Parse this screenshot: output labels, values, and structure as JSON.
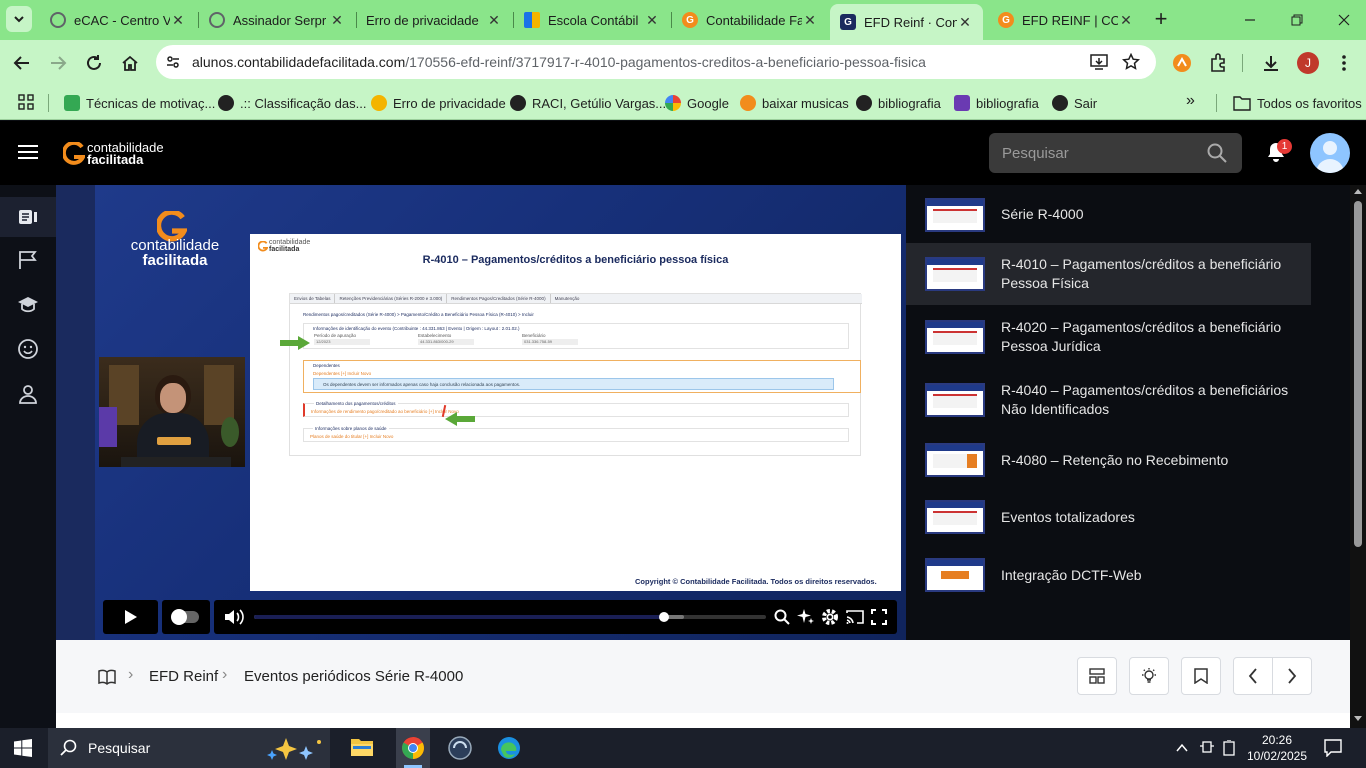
{
  "browser": {
    "tabs": [
      {
        "title": "eCAC - Centro V",
        "favicon": "globe-icon",
        "color": "#5f6368"
      },
      {
        "title": "Assinador Serpr",
        "favicon": "globe-icon",
        "color": "#5f6368"
      },
      {
        "title": "Erro de privacidade",
        "favicon": "none",
        "color": "#5f6368"
      },
      {
        "title": "Escola Contábil",
        "favicon": "windows-grid-icon",
        "color": "#1a73e8"
      },
      {
        "title": "Contabilidade Fa",
        "favicon": "cf-logo-icon",
        "color": "#f28c1c"
      },
      {
        "title": "EFD Reinf · Cont",
        "favicon": "cf-logo-dark-icon",
        "color": "#1a2a5e"
      },
      {
        "title": "EFD REINF | CON",
        "favicon": "cf-logo-icon",
        "color": "#f28c1c"
      }
    ],
    "url_host": "alunos.contabilidadefacilitada.com",
    "url_path": "/170556-efd-reinf/3717917-r-4010-pagamentos-creditos-a-beneficiario-pessoa-fisica",
    "profile_initial": "J",
    "bookmarks": [
      {
        "label": "Técnicas de motivaç...",
        "color": "#34a853"
      },
      {
        "label": ".:: Classificação das...",
        "color": "#222222"
      },
      {
        "label": "Erro de privacidade",
        "color": "#f4b400"
      },
      {
        "label": "RACI, Getúlio Vargas...",
        "color": "#222222"
      },
      {
        "label": "Google",
        "color": "#4285f4"
      },
      {
        "label": "baixar musicas",
        "color": "#f28c1c"
      },
      {
        "label": "bibliografia",
        "color": "#222222"
      },
      {
        "label": "bibliografia",
        "color": "#6a3ab2"
      },
      {
        "label": "Sair",
        "color": "#222222"
      }
    ],
    "all_bookmarks": "Todos os favoritos"
  },
  "site": {
    "logo_line1": "contabilidade",
    "logo_line2": "facilitada",
    "search_placeholder": "Pesquisar",
    "notification_count": "1"
  },
  "slide": {
    "brand_line1": "contabilidade",
    "brand_line2": "facilitada",
    "small_logo_line1": "contabilidade",
    "small_logo_line2": "facilitada",
    "title": "R-4010 – Pagamentos/créditos a beneficiário pessoa física",
    "tabs": [
      "Envios de Tabelas",
      "Retenções Previdenciárias (Séries R-2000 e 3.000)",
      "Rendimentos Pagos/Creditados (Série R-4000)",
      "Manutenção"
    ],
    "breadcrumb": "Rendimentos pagos/creditados (Série R-4000) > Pagamento/Crédito a Beneficiário Pessoa Física (R-4010) > Incluir",
    "section1": "Informações de identificação do evento (Contribuinte : 44.331.863 | Evento | Origem : Layout : 2.01.02.)",
    "field1_label": "Período de apuração",
    "field1_value": "12/2023",
    "field2_label": "Estabelecimento",
    "field2_value": "44.331.863/000-29",
    "field3_label": "Beneficiário",
    "field3_value": "031.336.758-59",
    "section2": "Dependentes",
    "section2_link": "Dependentes  [+] Incluir Novo",
    "section2_info": "Os dependentes devem ser informados apenas caso haja conclusão relacionada aos pagamentos.",
    "section3": "Detalhamento dos pagamentos/créditos",
    "section3_link": "Informações de rendimento pago/creditado ao beneficiário  [+] Incluir Novo",
    "section4": "Informações sobre planos de saúde",
    "section4_link": "Planos de saúde do titular  [+] Incluir Novo",
    "copyright": "Copyright © Contabilidade Facilitada. Todos os direitos reservados."
  },
  "player": {
    "progress": 0.8,
    "buffered": 0.84
  },
  "lessons": [
    {
      "title": "Série R-4000",
      "active": false
    },
    {
      "title": "R-4010 – Pagamentos/créditos a beneficiário Pessoa Física",
      "active": true
    },
    {
      "title": "R-4020 – Pagamentos/créditos a beneficiário Pessoa Jurídica",
      "active": false
    },
    {
      "title": "R-4040 – Pagamentos/créditos a beneficiários Não Identificados",
      "active": false
    },
    {
      "title": "R-4080 – Retenção no Recebimento",
      "active": false
    },
    {
      "title": "Eventos totalizadores",
      "active": false
    },
    {
      "title": "Integração DCTF-Web",
      "active": false
    }
  ],
  "breadcrumb": {
    "course": "EFD Reinf",
    "module": "Eventos periódicos Série R-4000"
  },
  "taskbar": {
    "search_placeholder": "Pesquisar",
    "time": "20:26",
    "date": "10/02/2025"
  },
  "colors": {
    "tab_strip": "#8ae58a",
    "toolbar": "#c6f5c6",
    "brand_orange": "#f28c1c",
    "notif_red": "#e53935",
    "avatar_blue": "#8ec5ff"
  }
}
